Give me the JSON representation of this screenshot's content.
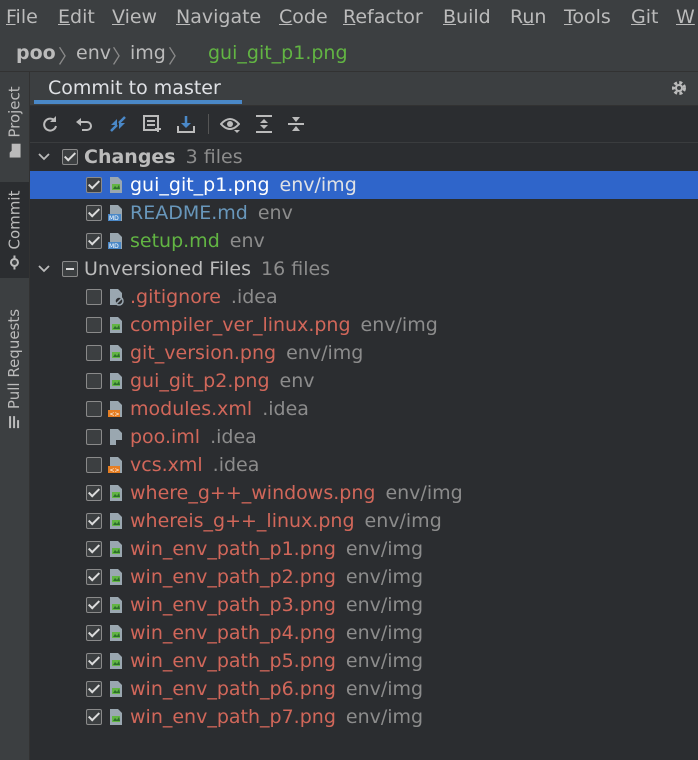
{
  "menu": [
    "File",
    "Edit",
    "View",
    "Navigate",
    "Code",
    "Refactor",
    "Build",
    "Run",
    "Tools",
    "Git",
    "W"
  ],
  "menu_mnemonic": [
    "F",
    "E",
    "V",
    "N",
    "C",
    "R",
    "B",
    "u",
    "T",
    "G",
    "W"
  ],
  "breadcrumb": {
    "project": "poo",
    "dir1": "env",
    "dir2": "img",
    "file": "gui_git_p1.png"
  },
  "toolstrip": {
    "project": "Project",
    "commit": "Commit",
    "pull_requests": "Pull Requests"
  },
  "panel": {
    "title": "Commit to master"
  },
  "toolbar_icons": [
    "refresh-icon",
    "rollback-icon",
    "diff-icon",
    "shelve-icon",
    "update-icon",
    "eye-icon",
    "expand-all-icon",
    "collapse-all-icon"
  ],
  "changes": {
    "label": "Changes",
    "count": "3 files",
    "files": [
      {
        "name": "gui_git_p1.png",
        "path": "env/img",
        "status": "modified",
        "checked": true,
        "selected": true,
        "icon": "image-file-icon"
      },
      {
        "name": "README.md",
        "path": "env",
        "status": "modified",
        "checked": true,
        "selected": false,
        "icon": "markdown-file-icon"
      },
      {
        "name": "setup.md",
        "path": "env",
        "status": "added",
        "checked": true,
        "selected": false,
        "icon": "markdown-file-icon"
      }
    ]
  },
  "unversioned": {
    "label": "Unversioned Files",
    "count": "16 files",
    "files": [
      {
        "name": ".gitignore",
        "path": ".idea",
        "checked": false,
        "icon": "ignore-file-icon"
      },
      {
        "name": "compiler_ver_linux.png",
        "path": "env/img",
        "checked": false,
        "icon": "image-file-icon"
      },
      {
        "name": "git_version.png",
        "path": "env/img",
        "checked": false,
        "icon": "image-file-icon"
      },
      {
        "name": "gui_git_p2.png",
        "path": "env",
        "checked": false,
        "icon": "image-file-icon"
      },
      {
        "name": "modules.xml",
        "path": ".idea",
        "checked": false,
        "icon": "xml-file-icon"
      },
      {
        "name": "poo.iml",
        "path": ".idea",
        "checked": false,
        "icon": "module-file-icon"
      },
      {
        "name": "vcs.xml",
        "path": ".idea",
        "checked": false,
        "icon": "xml-file-icon"
      },
      {
        "name": "where_g++_windows.png",
        "path": "env/img",
        "checked": true,
        "icon": "image-file-icon"
      },
      {
        "name": "whereis_g++_linux.png",
        "path": "env/img",
        "checked": true,
        "icon": "image-file-icon"
      },
      {
        "name": "win_env_path_p1.png",
        "path": "env/img",
        "checked": true,
        "icon": "image-file-icon"
      },
      {
        "name": "win_env_path_p2.png",
        "path": "env/img",
        "checked": true,
        "icon": "image-file-icon"
      },
      {
        "name": "win_env_path_p3.png",
        "path": "env/img",
        "checked": true,
        "icon": "image-file-icon"
      },
      {
        "name": "win_env_path_p4.png",
        "path": "env/img",
        "checked": true,
        "icon": "image-file-icon"
      },
      {
        "name": "win_env_path_p5.png",
        "path": "env/img",
        "checked": true,
        "icon": "image-file-icon"
      },
      {
        "name": "win_env_path_p6.png",
        "path": "env/img",
        "checked": true,
        "icon": "image-file-icon"
      },
      {
        "name": "win_env_path_p7.png",
        "path": "env/img",
        "checked": true,
        "icon": "image-file-icon"
      }
    ]
  },
  "colors": {
    "selection": "#2f65ca",
    "modified": "#6897bb",
    "added": "#62b543",
    "unversioned": "#d1675a",
    "accent": "#4a88c7"
  }
}
